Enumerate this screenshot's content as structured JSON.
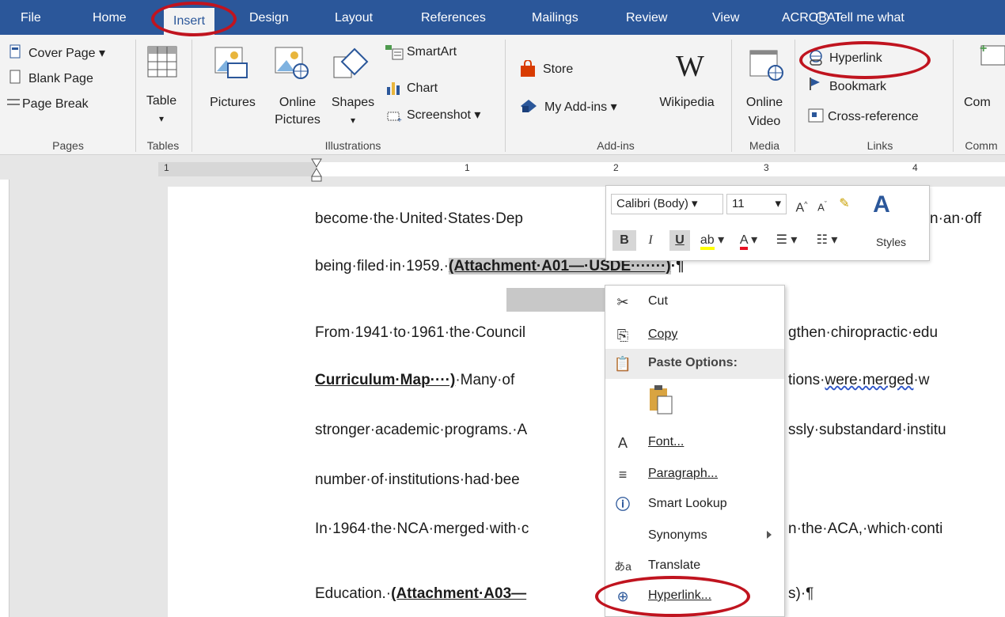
{
  "tabs": [
    "File",
    "Home",
    "Insert",
    "Design",
    "Layout",
    "References",
    "Mailings",
    "Review",
    "View",
    "ACROBAT"
  ],
  "tell_me": "Tell me what",
  "ribbon": {
    "pages": {
      "cover_page": "Cover Page",
      "blank_page": "Blank Page",
      "page_break": "Page Break",
      "label": "Pages"
    },
    "tables": {
      "table": "Table",
      "label": "Tables"
    },
    "illustrations": {
      "pictures": "Pictures",
      "online": "Online",
      "pictures2": "Pictures",
      "shapes": "Shapes",
      "smartart": "SmartArt",
      "chart": "Chart",
      "screenshot": "Screenshot",
      "label": "Illustrations"
    },
    "addins": {
      "store": "Store",
      "my_addins": "My Add-ins",
      "wikipedia": "Wikipedia",
      "label": "Add-ins"
    },
    "media": {
      "online": "Online",
      "video": "Video",
      "label": "Media"
    },
    "links": {
      "hyperlink": "Hyperlink",
      "bookmark": "Bookmark",
      "cross_reference": "Cross-reference",
      "label": "Links"
    },
    "comments": {
      "com": "Com",
      "label": "Comm"
    }
  },
  "ruler": {
    "marks": [
      "1",
      "1",
      "2",
      "3",
      "4"
    ]
  },
  "document": {
    "line1": "become·the·United·States·Dep",
    "line1_end": "n·an·off",
    "line2_pre": "being·filed·in·1959.·",
    "line2_sel": "(Attachment·A01—·USDE·······)",
    "line2_post": "·¶",
    "line3": "From·1941·to·1961·the·Council",
    "line3_end": "gthen·chiropractic·edu",
    "line4_pre": "Curriculum·Map····)",
    "line4_mid": "·Many·of",
    "line4_end_a": "tions·",
    "line4_end_b": "were·merged",
    "line4_end_c": "·w",
    "line5": "stronger·academic·programs.·A",
    "line5_end": "ssly·substandard·institu",
    "line6": "number·of·institutions·had·bee",
    "line7": "In·1964·the·NCA·merged·with·c",
    "line7_end": "n·the·ACA,·which·conti",
    "line8_pre": "Education.·",
    "line8_b": "(Attachment·A03—",
    "line8_end": "s)·¶"
  },
  "mini_toolbar": {
    "font": "Calibri (Body)",
    "size": "11",
    "bold": "B",
    "italic": "I",
    "underline": "U",
    "styles": "Styles"
  },
  "context_menu": {
    "cut": "Cut",
    "copy": "Copy",
    "paste_options": "Paste Options:",
    "font": "Font...",
    "paragraph": "Paragraph...",
    "smart_lookup": "Smart Lookup",
    "synonyms": "Synonyms",
    "translate": "Translate",
    "hyperlink": "Hyperlink..."
  },
  "colors": {
    "ribbon_blue": "#2b579a",
    "highlight_red": "#c0141f"
  }
}
